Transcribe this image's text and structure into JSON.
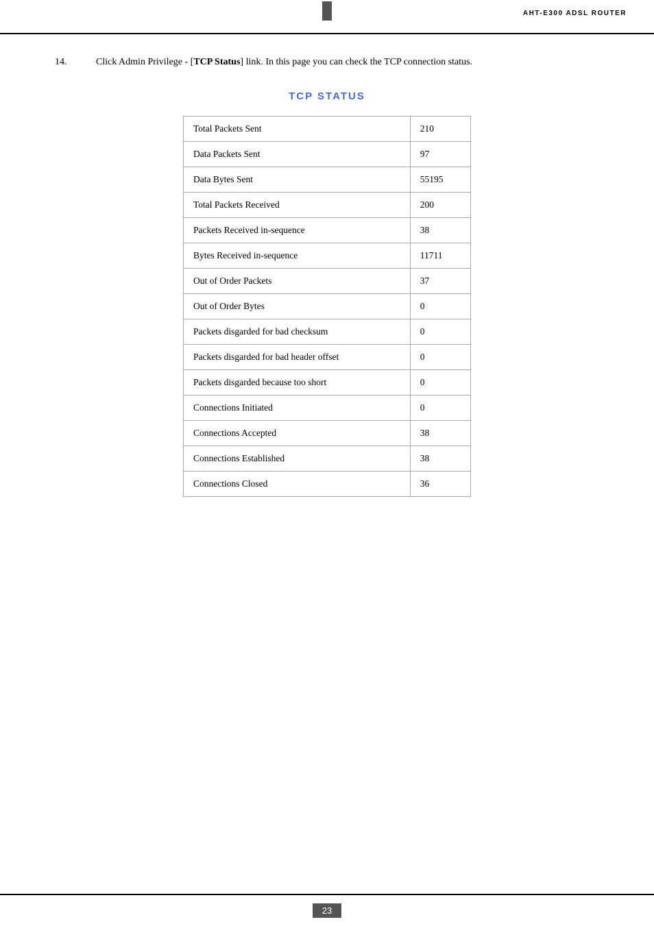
{
  "header": {
    "logo_text": "AHT-E300 ADSL ROUTER"
  },
  "footer": {
    "page_number": "23"
  },
  "instruction": {
    "step": "14.",
    "text_before": "Click Admin Privilege - [",
    "link_text": "TCP Status",
    "text_after": "] link. In this page you can check the TCP connection status."
  },
  "section_title": "TCP STATUS",
  "table": {
    "rows": [
      {
        "label": "Total Packets Sent",
        "value": "210"
      },
      {
        "label": "Data Packets Sent",
        "value": "97"
      },
      {
        "label": "Data Bytes Sent",
        "value": "55195"
      },
      {
        "label": "Total Packets Received",
        "value": "200"
      },
      {
        "label": "Packets Received in-sequence",
        "value": "38"
      },
      {
        "label": "Bytes Received in-sequence",
        "value": "11711"
      },
      {
        "label": "Out of Order Packets",
        "value": "37"
      },
      {
        "label": "Out of Order Bytes",
        "value": "0"
      },
      {
        "label": "Packets disgarded for bad checksum",
        "value": "0"
      },
      {
        "label": "Packets disgarded for bad header offset",
        "value": "0"
      },
      {
        "label": "Packets disgarded because too short",
        "value": "0"
      },
      {
        "label": "Connections Initiated",
        "value": "0"
      },
      {
        "label": "Connections Accepted",
        "value": "38"
      },
      {
        "label": "Connections Established",
        "value": "38"
      },
      {
        "label": "Connections Closed",
        "value": "36"
      }
    ]
  }
}
